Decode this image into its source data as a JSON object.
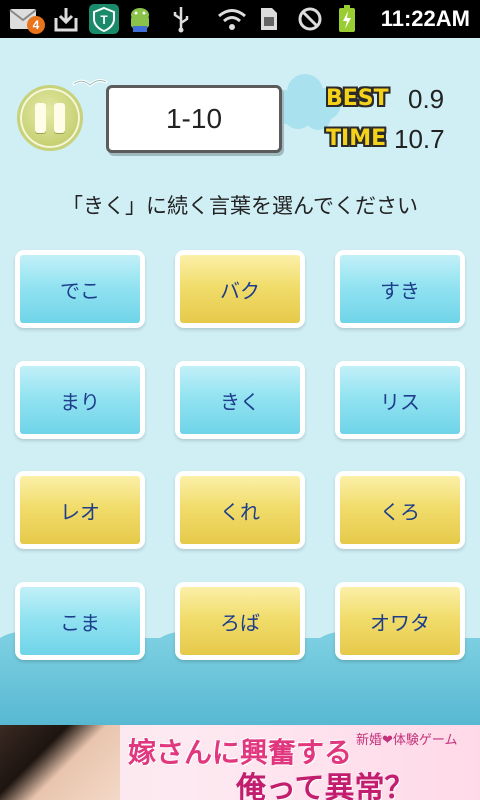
{
  "status_bar": {
    "notification_count": "4",
    "time": "11:22AM",
    "icons": [
      "gmail-notification-icon",
      "download-icon",
      "security-app-icon",
      "android-debug-icon",
      "usb-icon",
      "wifi-icon",
      "sim-icon",
      "no-sound-icon",
      "battery-charging-icon"
    ]
  },
  "game": {
    "level": "1-10",
    "best_label": "BEST",
    "best_value": "0.9",
    "time_label": "TIME",
    "time_value": "10.7",
    "prompt": "「きく」に続く言葉を選んでください",
    "buttons": [
      {
        "label": "でこ",
        "color": "blue"
      },
      {
        "label": "バク",
        "color": "yellow"
      },
      {
        "label": "すき",
        "color": "blue"
      },
      {
        "label": "まり",
        "color": "blue"
      },
      {
        "label": "きく",
        "color": "blue"
      },
      {
        "label": "リス",
        "color": "blue"
      },
      {
        "label": "レオ",
        "color": "yellow"
      },
      {
        "label": "くれ",
        "color": "yellow"
      },
      {
        "label": "くろ",
        "color": "yellow"
      },
      {
        "label": "こま",
        "color": "blue"
      },
      {
        "label": "ろば",
        "color": "yellow"
      },
      {
        "label": "オワタ",
        "color": "yellow"
      }
    ]
  },
  "ad": {
    "main_text": "嫁さんに興奮する",
    "sub_text": "俺って異常？",
    "tag_text": "新婚❤体験ゲーム"
  },
  "colors": {
    "sky": "#cfeff5",
    "sea": "#58b8d2",
    "blue_button": "#93e3f1",
    "yellow_button": "#f1dd6c",
    "button_text": "#1e3e8c",
    "stat_label": "#f5d21a"
  }
}
